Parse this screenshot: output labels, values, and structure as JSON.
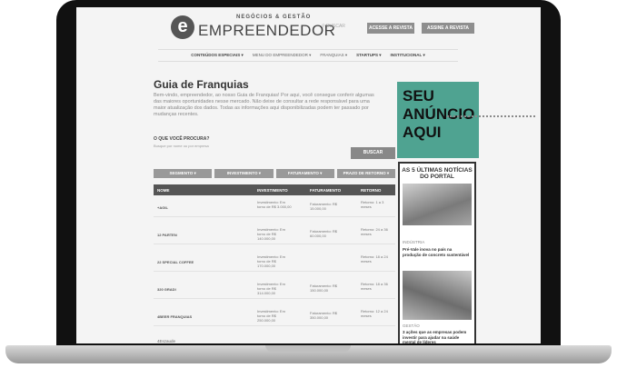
{
  "header": {
    "logo_letter": "e",
    "logo_tagline": "NEGÓCIOS & GESTÃO",
    "logo_name": "EMPREENDEDOR",
    "search_placeholder": "BUSCAR",
    "btn_access": "ACESSE A REVISTA",
    "btn_subscribe": "ASSINE A REVISTA"
  },
  "nav": [
    "CONTEÚDOS ESPECIAIS ▾",
    "MENU DO EMPREENDEDOR ▾",
    "FRANQUIAS ▾",
    "STARTUPS ▾",
    "INSTITUCIONAL ▾"
  ],
  "page": {
    "title": "Guia de Franquias",
    "intro": "Bem-vindo, empreendedor, ao nosso Guia de Franquias! Por aqui, você consegue conferir algumas das maiores oportunidades nesse mercado. Não deixe de consultar a rede responsável para uma maior atualização dos dados. Todas as informações aqui disponibilizadas podem ter passado por mudanças recentes."
  },
  "search": {
    "label": "O QUE VOCÊ PROCURA?",
    "placeholder": "Busque por nome ou por empresa",
    "button": "BUSCAR"
  },
  "filters": [
    "SEGMENTO ▾",
    "INVESTIMENTO ▾",
    "FATURAMENTO ▾",
    "PRAZO DE RETORNO ▾"
  ],
  "table": {
    "headers": [
      "NOME",
      "INVESTIMENTO",
      "FATURAMENTO",
      "RETORNO"
    ],
    "rows": [
      {
        "name": "+AGIL",
        "investment": "Investimento: Em torno de R$ 3.000,00",
        "revenue": "Faturamento: R$ 15.000,00",
        "return": "Retorno: 1 a 3 meses"
      },
      {
        "name": "12 PARTEN",
        "investment": "Investimento: Em torno de R$ 140.000,00",
        "revenue": "Faturamento: R$ 60.000,00",
        "return": "Retorno: 24 a 36 meses"
      },
      {
        "name": "22 SPECIAL COFFEE",
        "investment": "Investimento: Em torno de R$ 170.000,00",
        "revenue": "",
        "return": "Retorno: 18 a 24 meses"
      },
      {
        "name": "320 GRADI",
        "investment": "Investimento: Em torno de R$ 314.000,00",
        "revenue": "Faturamento: R$ 150.000,00",
        "return": "Retorno: 18 a 36 meses"
      },
      {
        "name": "4BEER FRANQUIAS",
        "investment": "Investimento: Em torno de R$ 250.000,00",
        "revenue": "Faturamento: R$ 350.000,00",
        "return": "Retorno: 12 a 24 meses"
      }
    ],
    "partial_row": "4Eszaude"
  },
  "ad": {
    "text": "SEU ANÚNCIO AQUI",
    "color": "#4fa391"
  },
  "news": {
    "heading": "AS 5 ÚLTIMAS NOTÍCIAS DO PORTAL",
    "items": [
      {
        "category": "INDÚSTRIA",
        "title": "Pré-Vale inova no país na produção de concreto sustentável"
      },
      {
        "category": "GESTÃO",
        "title": "3 ações que as empresas podem investir para ajudar na saúde mental de líderes"
      }
    ]
  }
}
